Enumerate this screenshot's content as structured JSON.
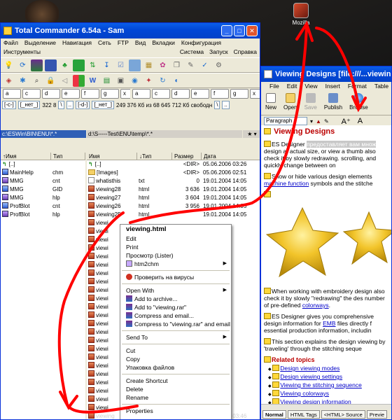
{
  "desktop": {
    "icon_label": "Mozilla"
  },
  "tc": {
    "title": "Total Commander 6.54a - Sam",
    "menu": [
      "Файл",
      "Выделение",
      "Навигация",
      "Сеть",
      "FTP",
      "Вид",
      "Вкладки",
      "Конфигурация"
    ],
    "menu2_left": "Инструменты",
    "menu2_right": [
      "Система",
      "Запуск",
      "Справка"
    ],
    "drive_tabs_left": [
      "a",
      "c",
      "d",
      "e",
      "f",
      "g",
      "x",
      "z"
    ],
    "drive_tabs_right": [
      "a",
      "c",
      "d",
      "e",
      "f",
      "g",
      "x",
      "z"
    ],
    "left_drive": "[-c-]",
    "left_net": "[_нет_]",
    "left_free": "322 8",
    "right_drive": "[-d-]",
    "right_net": "[_нет_]",
    "right_free": "249 376 Кб из 68 645 712 Кб свободн",
    "left_path": "c:\\ESWin\\BIN\\ENU\\*.*",
    "right_path": "d:\\S-----Test\\ENU\\temp\\*.*",
    "left_cols": [
      "↑Имя",
      "Тип"
    ],
    "right_cols": [
      "Имя",
      "↓Тип",
      "Размер",
      "Дата"
    ],
    "left_files": [
      {
        "name": "[..]",
        "type": "",
        "kind": "up"
      },
      {
        "name": "MainHelp",
        "type": "chm",
        "kind": "file"
      },
      {
        "name": "MMG",
        "type": "cnt",
        "kind": "file"
      },
      {
        "name": "MMG",
        "type": "GID",
        "kind": "file"
      },
      {
        "name": "MMG",
        "type": "hlp",
        "kind": "file"
      },
      {
        "name": "ProfBlot",
        "type": "cnt",
        "kind": "file"
      },
      {
        "name": "ProfBlot",
        "type": "hlp",
        "kind": "file"
      }
    ],
    "right_files": [
      {
        "name": "[..]",
        "type": "",
        "size": "<DIR>",
        "date": "05.06.2006 03:26",
        "kind": "up"
      },
      {
        "name": "[Images]",
        "type": "",
        "size": "<DIR>",
        "date": "05.06.2006 02:51",
        "kind": "dir"
      },
      {
        "name": "whatisthis",
        "type": "txt",
        "size": "0",
        "date": "19.01.2004 14:05",
        "kind": "plain"
      },
      {
        "name": "viewing28",
        "type": "html",
        "size": "3 636",
        "date": "19.01.2004 14:05",
        "kind": "file"
      },
      {
        "name": "viewing27",
        "type": "html",
        "size": "3 604",
        "date": "19.01.2004 14:05",
        "kind": "file"
      },
      {
        "name": "viewing26",
        "type": "html",
        "size": "3 956",
        "date": "19.01.2004 14:05",
        "kind": "file"
      },
      {
        "name": "viewing25",
        "type": "html",
        "size": "",
        "date": "19.01.2004 14:05",
        "kind": "file"
      },
      {
        "name": "viewi",
        "type": "",
        "size": "",
        "date": "",
        "kind": "file"
      },
      {
        "name": "viewi",
        "type": "",
        "size": "",
        "date": "",
        "kind": "file"
      },
      {
        "name": "viewi",
        "type": "",
        "size": "",
        "date": "",
        "kind": "file"
      },
      {
        "name": "viewi",
        "type": "",
        "size": "",
        "date": "",
        "kind": "file"
      },
      {
        "name": "viewi",
        "type": "",
        "size": "",
        "date": "",
        "kind": "file"
      },
      {
        "name": "viewi",
        "type": "",
        "size": "",
        "date": "",
        "kind": "file"
      },
      {
        "name": "viewi",
        "type": "",
        "size": "",
        "date": "",
        "kind": "file"
      },
      {
        "name": "viewi",
        "type": "",
        "size": "",
        "date": "",
        "kind": "file"
      },
      {
        "name": "viewi",
        "type": "",
        "size": "",
        "date": "",
        "kind": "file"
      },
      {
        "name": "viewi",
        "type": "",
        "size": "",
        "date": "",
        "kind": "file"
      },
      {
        "name": "viewi",
        "type": "",
        "size": "",
        "date": "",
        "kind": "file"
      },
      {
        "name": "viewi",
        "type": "",
        "size": "",
        "date": "",
        "kind": "file"
      },
      {
        "name": "viewi",
        "type": "",
        "size": "",
        "date": "",
        "kind": "file"
      },
      {
        "name": "viewi",
        "type": "",
        "size": "",
        "date": "",
        "kind": "file"
      },
      {
        "name": "viewi",
        "type": "",
        "size": "",
        "date": "",
        "kind": "file"
      },
      {
        "name": "viewi",
        "type": "",
        "size": "",
        "date": "",
        "kind": "file"
      },
      {
        "name": "viewi",
        "type": "",
        "size": "",
        "date": "",
        "kind": "file"
      },
      {
        "name": "viewi",
        "type": "",
        "size": "",
        "date": "",
        "kind": "file"
      },
      {
        "name": "viewi",
        "type": "",
        "size": "",
        "date": "",
        "kind": "file"
      },
      {
        "name": "viewi",
        "type": "",
        "size": "",
        "date": "",
        "kind": "file"
      },
      {
        "name": "viewi",
        "type": "",
        "size": "",
        "date": "",
        "kind": "file"
      },
      {
        "name": "viewi",
        "type": "",
        "size": "",
        "date": "",
        "kind": "file"
      },
      {
        "name": "viewi",
        "type": "",
        "size": "",
        "date": "",
        "kind": "file"
      },
      {
        "name": "viewing",
        "type": "html",
        "size": "6 408",
        "date": "05.06.2006 03:46",
        "kind": "hl"
      },
      {
        "name": "vectors21",
        "type": "html",
        "size": "2 711",
        "date": "19.01.2004 14:05",
        "kind": "file"
      }
    ],
    "context_menu": {
      "title": "viewing.html",
      "group1": [
        "Edit",
        "Print",
        "Просмотр (Lister)",
        "htm2chm"
      ],
      "virus": "Проверить на вирусы",
      "group2": [
        "Open With",
        "Add to archive...",
        "Add to \"viewing.rar\"",
        "Compress and email...",
        "Compress to \"viewing.rar\" and email"
      ],
      "send_to": "Send To",
      "group3": [
        "Cut",
        "Copy",
        "Упаковка файлов"
      ],
      "group4": [
        "Create Shortcut",
        "Delete",
        "Rename"
      ],
      "properties": "Properties"
    }
  },
  "vd": {
    "title": "Viewing Designs [file:///...viewing.htm",
    "menu": [
      "File",
      "Edit",
      "View",
      "Insert",
      "Format",
      "Table"
    ],
    "toolbar": [
      "New",
      "Open",
      "Save",
      "Publish",
      "Browse"
    ],
    "paragraph": "Paragraph",
    "heading": "Viewing Designs",
    "p1_a": "ES Designer ",
    "p1_hl": "предоставляет вам множ",
    "p1_b": "design at actual size, or view a thumb also check it by slowly redrawing. scrolling, and quickly change between on",
    "p2": "Show or hide various design elements",
    "p2_link": "machine function",
    "p2_b": " symbols and the stitche",
    "p3": "When working with embroidery design also check it by slowly \"redrawing\" the des number of pre-defined ",
    "p3_link": "colorways",
    "p4_a": "ES Designer gives you comprehensive design information for ",
    "p4_link": "EMB",
    "p4_b": " files directly f essential production information, includin",
    "p5": "This section explains the design viewing by 'traveling' through the stitching seque",
    "related_title": "Related topics",
    "related": [
      "Design viewing modes",
      "Design viewing settings",
      "Viewing the stitching sequence",
      "Viewing colorways",
      "Viewing design information"
    ],
    "tabs": [
      "Normal",
      "HTML Tags",
      "<HTML> Source",
      "Previe"
    ]
  },
  "colors": {
    "xp_blue": "#0a5ee8",
    "annotation_red": "#ff0000",
    "heading_red": "#b00000"
  }
}
